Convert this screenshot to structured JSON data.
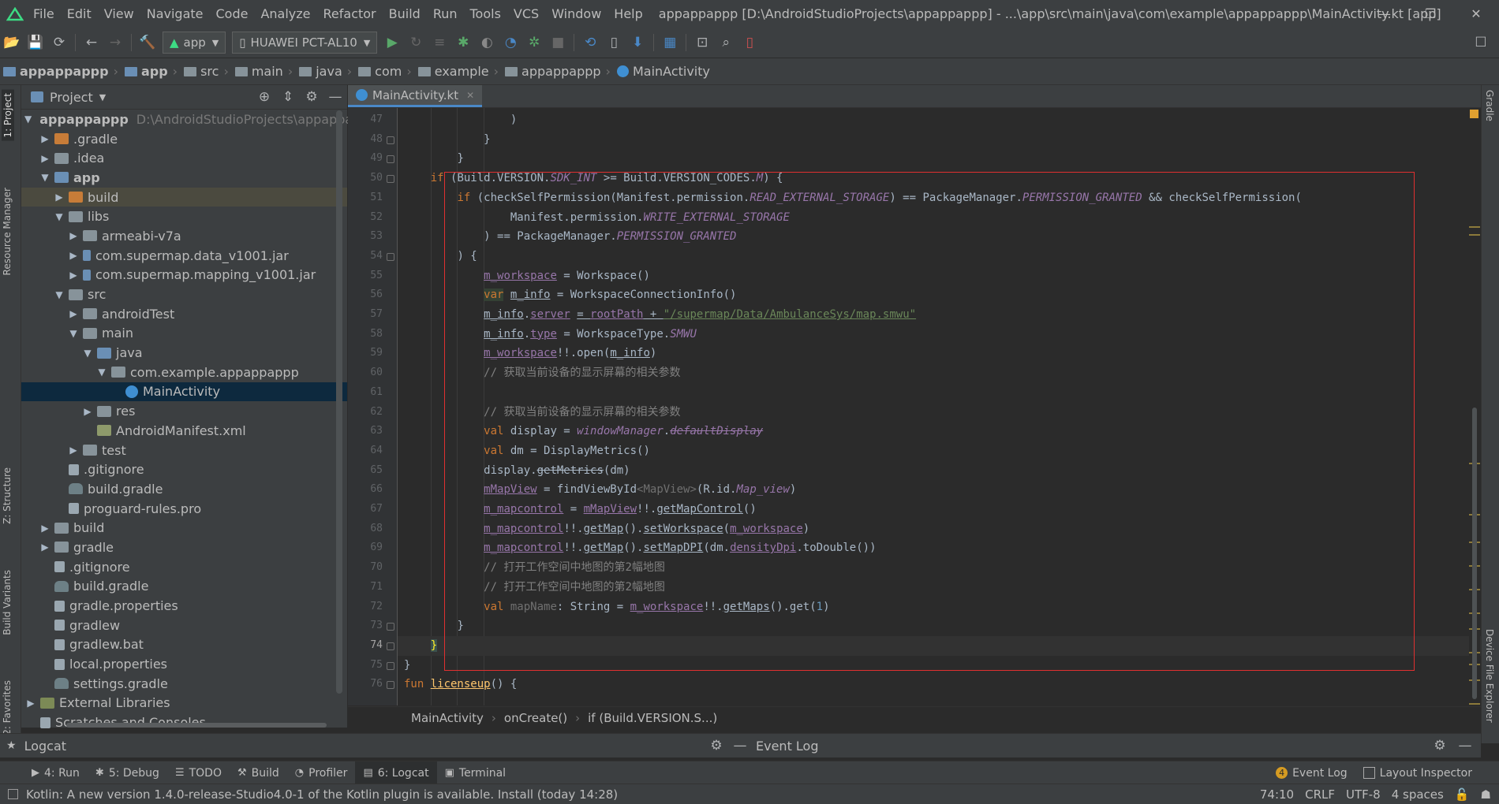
{
  "menubar": {
    "items": [
      "File",
      "Edit",
      "View",
      "Navigate",
      "Code",
      "Analyze",
      "Refactor",
      "Build",
      "Run",
      "Tools",
      "VCS",
      "Window",
      "Help"
    ],
    "title": "appappappp [D:\\AndroidStudioProjects\\appappappp] - ...\\app\\src\\main\\java\\com\\example\\appappappp\\MainActivity.kt [app]"
  },
  "toolbar": {
    "config": "app",
    "device": "HUAWEI PCT-AL10"
  },
  "breadcrumb": [
    "appappappp",
    "app",
    "src",
    "main",
    "java",
    "com",
    "example",
    "appappappp",
    "MainActivity"
  ],
  "left_stripe": {
    "tabs": [
      "1: Project",
      "Resource Manager",
      "Z: Structure",
      "Build Variants",
      "2: Favorites"
    ]
  },
  "right_stripe": {
    "tabs": [
      "Gradle",
      "Device File Explorer"
    ]
  },
  "project": {
    "title": "Project",
    "root_path": "D:\\AndroidStudioProjects\\appappap",
    "tree": [
      {
        "label": "appappappp",
        "depth": 0,
        "arrow": "▼",
        "icon": "bfolder",
        "bold": true
      },
      {
        "label": ".gradle",
        "depth": 1,
        "arrow": "▶",
        "icon": "ofolder"
      },
      {
        "label": ".idea",
        "depth": 1,
        "arrow": "▶",
        "icon": "folder"
      },
      {
        "label": "app",
        "depth": 1,
        "arrow": "▼",
        "icon": "bfolder",
        "bold": true
      },
      {
        "label": "build",
        "depth": 2,
        "arrow": "▶",
        "icon": "ofolder",
        "hl": true
      },
      {
        "label": "libs",
        "depth": 2,
        "arrow": "▼",
        "icon": "folder"
      },
      {
        "label": "armeabi-v7a",
        "depth": 3,
        "arrow": "▶",
        "icon": "folder"
      },
      {
        "label": "com.supermap.data_v1001.jar",
        "depth": 3,
        "arrow": "▶",
        "icon": "jar"
      },
      {
        "label": "com.supermap.mapping_v1001.jar",
        "depth": 3,
        "arrow": "▶",
        "icon": "jar"
      },
      {
        "label": "src",
        "depth": 2,
        "arrow": "▼",
        "icon": "folder"
      },
      {
        "label": "androidTest",
        "depth": 3,
        "arrow": "▶",
        "icon": "folder"
      },
      {
        "label": "main",
        "depth": 3,
        "arrow": "▼",
        "icon": "folder"
      },
      {
        "label": "java",
        "depth": 4,
        "arrow": "▼",
        "icon": "bfolder"
      },
      {
        "label": "com.example.appappappp",
        "depth": 5,
        "arrow": "▼",
        "icon": "folder"
      },
      {
        "label": "MainActivity",
        "depth": 6,
        "arrow": "",
        "icon": "kt",
        "sel": true
      },
      {
        "label": "res",
        "depth": 4,
        "arrow": "▶",
        "icon": "folder"
      },
      {
        "label": "AndroidManifest.xml",
        "depth": 4,
        "arrow": "",
        "icon": "xml"
      },
      {
        "label": "test",
        "depth": 3,
        "arrow": "▶",
        "icon": "folder"
      },
      {
        "label": ".gitignore",
        "depth": 2,
        "arrow": "",
        "icon": "file"
      },
      {
        "label": "build.gradle",
        "depth": 2,
        "arrow": "",
        "icon": "grad"
      },
      {
        "label": "proguard-rules.pro",
        "depth": 2,
        "arrow": "",
        "icon": "file"
      },
      {
        "label": "build",
        "depth": 1,
        "arrow": "▶",
        "icon": "folder"
      },
      {
        "label": "gradle",
        "depth": 1,
        "arrow": "▶",
        "icon": "folder"
      },
      {
        "label": ".gitignore",
        "depth": 1,
        "arrow": "",
        "icon": "file"
      },
      {
        "label": "build.gradle",
        "depth": 1,
        "arrow": "",
        "icon": "grad"
      },
      {
        "label": "gradle.properties",
        "depth": 1,
        "arrow": "",
        "icon": "file"
      },
      {
        "label": "gradlew",
        "depth": 1,
        "arrow": "",
        "icon": "file"
      },
      {
        "label": "gradlew.bat",
        "depth": 1,
        "arrow": "",
        "icon": "file"
      },
      {
        "label": "local.properties",
        "depth": 1,
        "arrow": "",
        "icon": "file"
      },
      {
        "label": "settings.gradle",
        "depth": 1,
        "arrow": "",
        "icon": "grad"
      },
      {
        "label": "External Libraries",
        "depth": 0,
        "arrow": "▶",
        "icon": "lib"
      },
      {
        "label": "Scratches and Consoles",
        "depth": 0,
        "arrow": "",
        "icon": "file"
      }
    ]
  },
  "editor": {
    "tab": "MainActivity.kt",
    "current_line": 74,
    "lines": [
      {
        "n": "47",
        "indent": 16,
        "t": [
          [
            "p",
            ")"
          ]
        ]
      },
      {
        "n": "48",
        "indent": 12,
        "t": [
          [
            "p",
            "}"
          ]
        ]
      },
      {
        "n": "49",
        "indent": 8,
        "t": [
          [
            "p",
            "}"
          ]
        ]
      },
      {
        "n": "50",
        "indent": 4,
        "t": [
          [
            "kw",
            "if "
          ],
          [
            "p",
            "(Build.VERSION."
          ],
          [
            "sfld",
            "SDK_INT"
          ],
          [
            "p",
            " >= Build.VERSION_CODES."
          ],
          [
            "sfld",
            "M"
          ],
          [
            "p",
            ") {"
          ]
        ]
      },
      {
        "n": "51",
        "indent": 8,
        "t": [
          [
            "kw",
            "if "
          ],
          [
            "p",
            "(checkSelfPermission(Manifest.permission."
          ],
          [
            "sfld",
            "READ_EXTERNAL_STORAGE"
          ],
          [
            "p",
            ") == PackageManager."
          ],
          [
            "sfld",
            "PERMISSION_GRANTED"
          ],
          [
            "p",
            " && checkSelfPermission("
          ]
        ]
      },
      {
        "n": "52",
        "indent": 16,
        "t": [
          [
            "p",
            "Manifest.permission."
          ],
          [
            "sfld",
            "WRITE_EXTERNAL_STORAGE"
          ]
        ]
      },
      {
        "n": "53",
        "indent": 12,
        "t": [
          [
            "p",
            ") == PackageManager."
          ],
          [
            "sfld",
            "PERMISSION_GRANTED"
          ]
        ]
      },
      {
        "n": "54",
        "indent": 8,
        "t": [
          [
            "p",
            ") {"
          ]
        ]
      },
      {
        "n": "55",
        "indent": 12,
        "t": [
          [
            "fldu",
            "m_workspace"
          ],
          [
            "p",
            " = Workspace()"
          ]
        ]
      },
      {
        "n": "56",
        "indent": 12,
        "t": [
          [
            "kwhl",
            "var"
          ],
          [
            "p",
            " "
          ],
          [
            "pu",
            "m_info"
          ],
          [
            "p",
            " = WorkspaceConnectionInfo()"
          ]
        ]
      },
      {
        "n": "57",
        "indent": 12,
        "t": [
          [
            "pu",
            "m_info"
          ],
          [
            "p",
            "."
          ],
          [
            "fldu",
            "server"
          ],
          [
            "p",
            " "
          ],
          [
            "pu2",
            "= "
          ],
          [
            "fldu",
            "rootPath"
          ],
          [
            "pu2",
            " + "
          ],
          [
            "stru",
            "\"/supermap/Data/AmbulanceSys/map.smwu\""
          ]
        ]
      },
      {
        "n": "58",
        "indent": 12,
        "t": [
          [
            "pu",
            "m_info"
          ],
          [
            "p",
            "."
          ],
          [
            "fldu",
            "type"
          ],
          [
            "p",
            " = WorkspaceType."
          ],
          [
            "sfld",
            "SMWU"
          ]
        ]
      },
      {
        "n": "59",
        "indent": 12,
        "t": [
          [
            "fldu",
            "m_workspace"
          ],
          [
            "p",
            "!!.open("
          ],
          [
            "pu",
            "m_info"
          ],
          [
            "p",
            ")"
          ]
        ]
      },
      {
        "n": "60",
        "indent": 12,
        "t": [
          [
            "cm",
            "// 获取当前设备的显示屏幕的相关参数"
          ]
        ]
      },
      {
        "n": "61",
        "indent": 0,
        "t": []
      },
      {
        "n": "62",
        "indent": 12,
        "t": [
          [
            "cm",
            "// 获取当前设备的显示屏幕的相关参数"
          ]
        ]
      },
      {
        "n": "63",
        "indent": 12,
        "t": [
          [
            "kw",
            "val "
          ],
          [
            "p",
            "display = "
          ],
          [
            "sfld",
            "windowManager"
          ],
          [
            "p",
            "."
          ],
          [
            "sfldst",
            "defaultDisplay"
          ]
        ]
      },
      {
        "n": "64",
        "indent": 12,
        "t": [
          [
            "kw",
            "val "
          ],
          [
            "p",
            "dm = DisplayMetrics()"
          ]
        ]
      },
      {
        "n": "65",
        "indent": 12,
        "t": [
          [
            "p",
            "display."
          ],
          [
            "pst",
            "getMetrics"
          ],
          [
            "p",
            "(dm)"
          ]
        ]
      },
      {
        "n": "66",
        "indent": 12,
        "t": [
          [
            "fldu",
            "mMapView"
          ],
          [
            "p",
            " = findViewById"
          ],
          [
            "gen",
            "<MapView>"
          ],
          [
            "p",
            "(R.id."
          ],
          [
            "sfld",
            "Map_view"
          ],
          [
            "p",
            ")"
          ]
        ]
      },
      {
        "n": "67",
        "indent": 12,
        "t": [
          [
            "fldu",
            "m_mapcontrol"
          ],
          [
            "p",
            " = "
          ],
          [
            "fldu",
            "mMapView"
          ],
          [
            "p",
            "!!."
          ],
          [
            "pu",
            "getMapControl"
          ],
          [
            "p",
            "()"
          ]
        ]
      },
      {
        "n": "68",
        "indent": 12,
        "t": [
          [
            "fldu",
            "m_mapcontrol"
          ],
          [
            "p",
            "!!."
          ],
          [
            "pu",
            "getMap"
          ],
          [
            "p",
            "()."
          ],
          [
            "pu",
            "setWorkspace"
          ],
          [
            "p",
            "("
          ],
          [
            "fldu",
            "m_workspace"
          ],
          [
            "p",
            ")"
          ]
        ]
      },
      {
        "n": "69",
        "indent": 12,
        "t": [
          [
            "fldu",
            "m_mapcontrol"
          ],
          [
            "p",
            "!!."
          ],
          [
            "pu",
            "getMap"
          ],
          [
            "p",
            "()."
          ],
          [
            "pu",
            "setMapDPI"
          ],
          [
            "p",
            "(dm."
          ],
          [
            "fldu",
            "densityDpi"
          ],
          [
            "p",
            ".toDouble())"
          ]
        ]
      },
      {
        "n": "70",
        "indent": 12,
        "t": [
          [
            "cm",
            "// 打开工作空间中地图的第2幅地图"
          ]
        ]
      },
      {
        "n": "71",
        "indent": 12,
        "t": [
          [
            "cm",
            "// 打开工作空间中地图的第2幅地图"
          ]
        ]
      },
      {
        "n": "72",
        "indent": 12,
        "t": [
          [
            "kw",
            "val "
          ],
          [
            "gen",
            "mapName"
          ],
          [
            "p",
            ": String = "
          ],
          [
            "fldu",
            "m_workspace"
          ],
          [
            "p",
            "!!."
          ],
          [
            "pu",
            "getMaps"
          ],
          [
            "p",
            "().get("
          ],
          [
            "num",
            "1"
          ],
          [
            "p",
            ")"
          ]
        ]
      },
      {
        "n": "73",
        "indent": 8,
        "t": [
          [
            "p",
            "}"
          ]
        ]
      },
      {
        "n": "74",
        "indent": 4,
        "t": [
          [
            "fn",
            "}"
          ]
        ]
      },
      {
        "n": "75",
        "indent": 0,
        "t": [
          [
            "p",
            "}"
          ]
        ]
      },
      {
        "n": "76",
        "indent": 0,
        "t": [
          [
            "kw",
            "fun "
          ],
          [
            "fnu",
            "licenseup"
          ],
          [
            "p",
            "() {"
          ]
        ]
      }
    ],
    "breadcrumb": [
      "MainActivity",
      "onCreate()",
      "if (Build.VERSION.S...)"
    ]
  },
  "bottom": {
    "logcat_title": "Logcat",
    "event_log_title": "Event Log",
    "tabs": [
      {
        "icon": "▶",
        "label": "4: Run"
      },
      {
        "icon": "✱",
        "label": "5: Debug"
      },
      {
        "icon": "☰",
        "label": "TODO"
      },
      {
        "icon": "⚒",
        "label": "Build"
      },
      {
        "icon": "◔",
        "label": "Profiler"
      },
      {
        "icon": "▤",
        "label": "6: Logcat",
        "active": true
      },
      {
        "icon": "▣",
        "label": "Terminal"
      }
    ],
    "right_tabs": [
      {
        "label": "Event Log",
        "badge": "4"
      },
      {
        "label": "Layout Inspector"
      }
    ]
  },
  "status": {
    "message": "Kotlin: A new version 1.4.0-release-Studio4.0-1 of the Kotlin plugin is available. Install (today 14:28)",
    "position": "74:10",
    "line_sep": "CRLF",
    "encoding": "UTF-8",
    "indent": "4 spaces"
  }
}
